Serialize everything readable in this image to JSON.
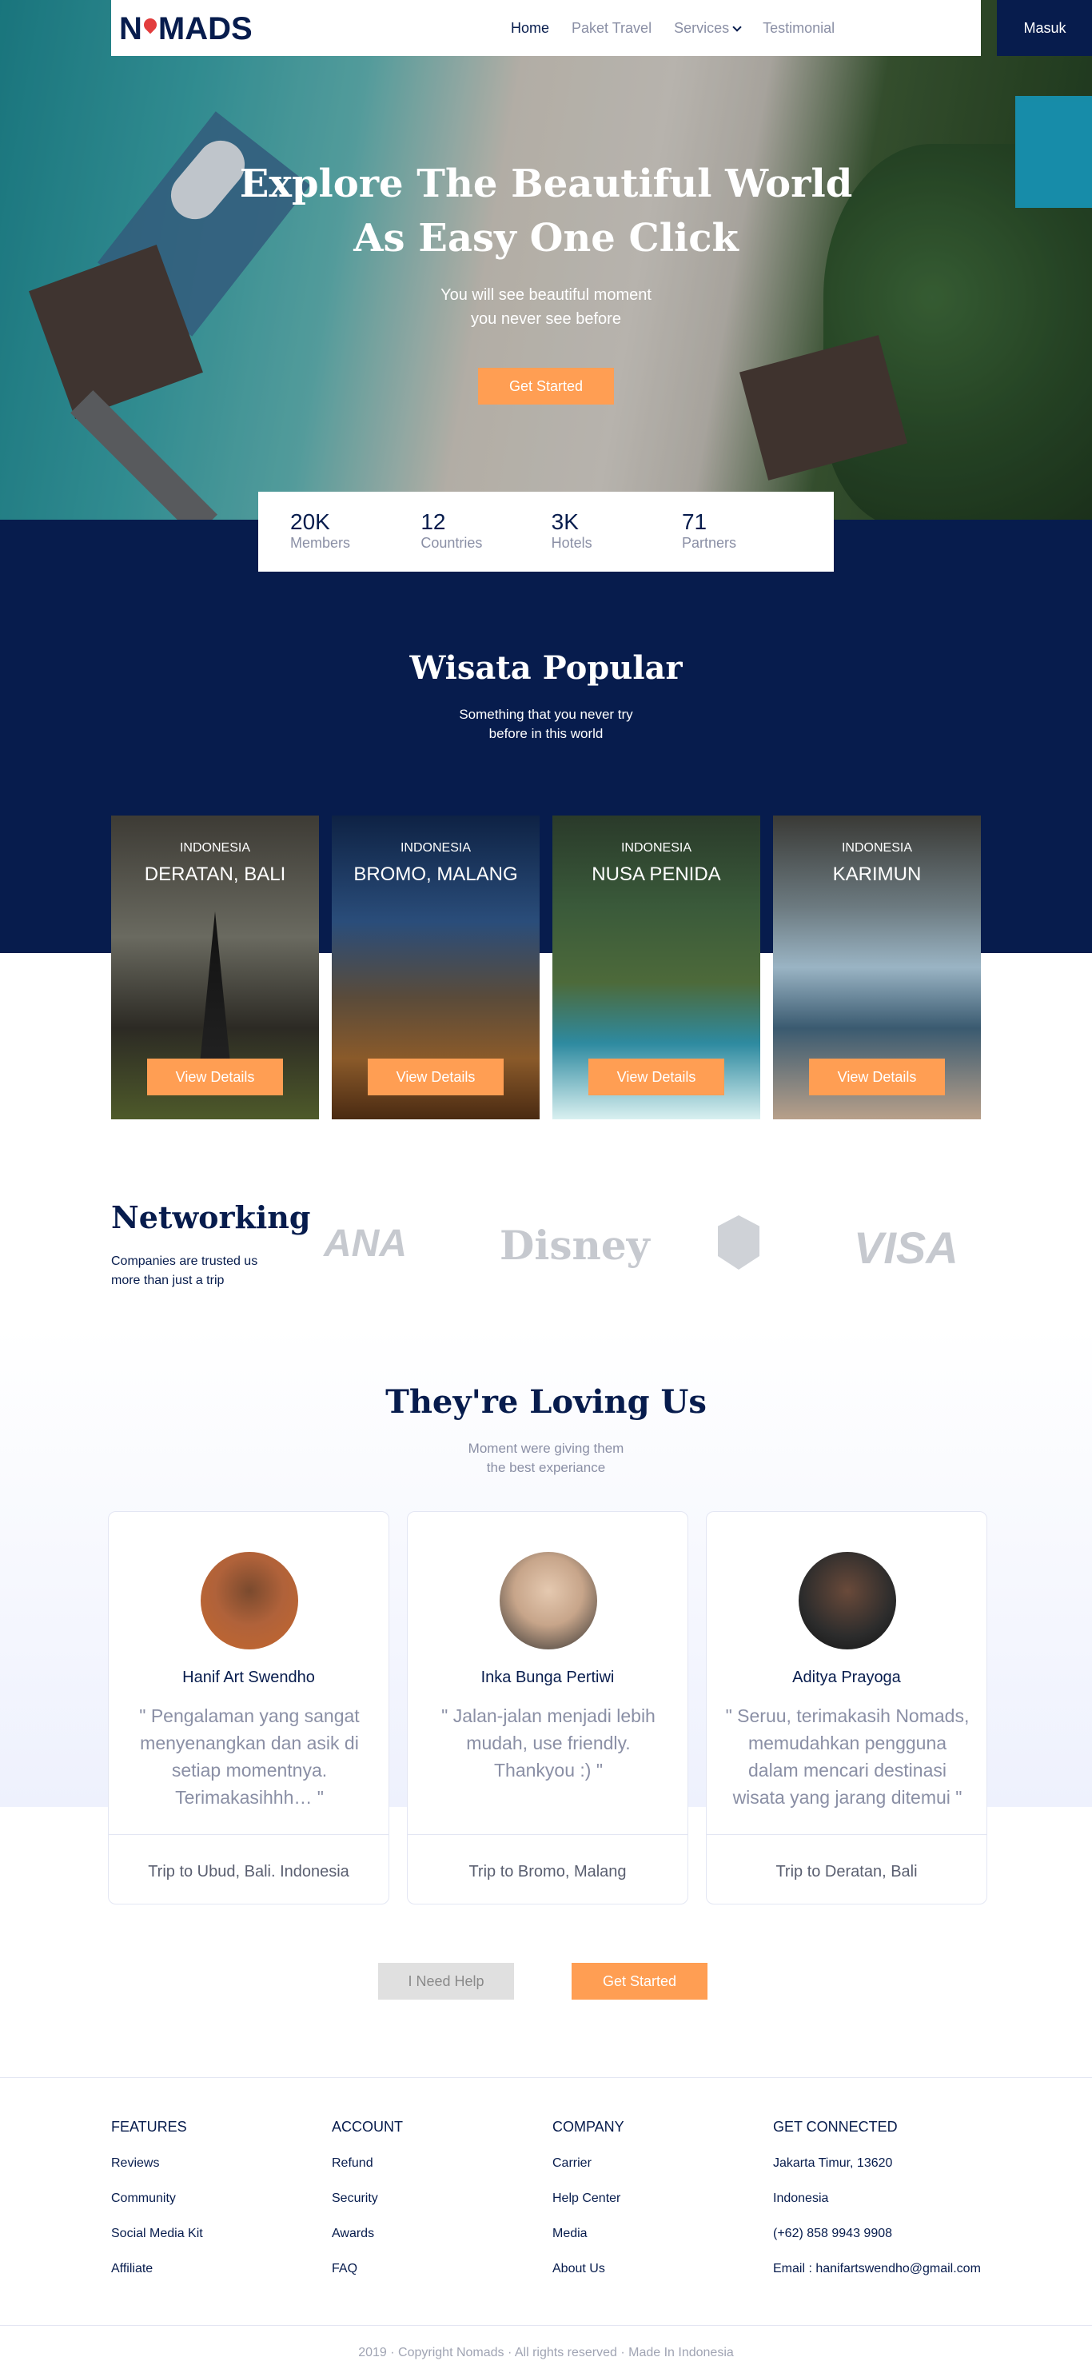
{
  "nav": {
    "logo": "NOMADS",
    "links": [
      "Home",
      "Paket Travel",
      "Services",
      "Testimonial"
    ],
    "masuk": "Masuk"
  },
  "hero": {
    "title_line1": "Explore The Beautiful World",
    "title_line2": "As Easy One Click",
    "sub_line1": "You will see beautiful moment",
    "sub_line2": "you never see before",
    "cta": "Get Started"
  },
  "stats": [
    {
      "num": "20K",
      "label": "Members"
    },
    {
      "num": "12",
      "label": "Countries"
    },
    {
      "num": "3K",
      "label": "Hotels"
    },
    {
      "num": "71",
      "label": "Partners"
    }
  ],
  "popular": {
    "title": "Wisata Popular",
    "sub_line1": "Something that you never try",
    "sub_line2": "before in this world",
    "cards": [
      {
        "country": "INDONESIA",
        "city": "DERATAN, BALI",
        "button": "View Details"
      },
      {
        "country": "INDONESIA",
        "city": "BROMO, MALANG",
        "button": "View Details"
      },
      {
        "country": "INDONESIA",
        "city": "NUSA PENIDA",
        "button": "View Details"
      },
      {
        "country": "INDONESIA",
        "city": "KARIMUN",
        "button": "View Details"
      }
    ]
  },
  "networking": {
    "title": "Networking",
    "sub_line1": "Companies are trusted us",
    "sub_line2": "more than just a trip",
    "partners": [
      "ANA",
      "Disney",
      "VISA"
    ]
  },
  "testimonials": {
    "title": "They're Loving Us",
    "sub_line1": "Moment were giving them",
    "sub_line2": "the best experiance",
    "items": [
      {
        "name": "Hanif Art Swendho",
        "quote": "\" Pengalaman yang sangat menyenangkan dan asik di setiap momentnya. Terimakasihhh… \"",
        "trip": "Trip to Ubud, Bali. Indonesia"
      },
      {
        "name": "Inka Bunga Pertiwi",
        "quote": "\" Jalan-jalan menjadi lebih mudah, use friendly. Thankyou :) \"",
        "trip": "Trip to Bromo, Malang"
      },
      {
        "name": "Aditya Prayoga",
        "quote": "\" Seruu, terimakasih Nomads, memudahkan pengguna dalam mencari destinasi wisata yang jarang ditemui \"",
        "trip": "Trip to Deratan, Bali"
      }
    ]
  },
  "cta_buttons": {
    "help": "I Need Help",
    "start": "Get Started"
  },
  "footer": {
    "features": {
      "title": "FEATURES",
      "links": [
        "Reviews",
        "Community",
        "Social Media Kit",
        "Affiliate"
      ]
    },
    "account": {
      "title": "ACCOUNT",
      "links": [
        "Refund",
        "Security",
        "Awards",
        "FAQ"
      ]
    },
    "company": {
      "title": "COMPANY",
      "links": [
        "Carrier",
        "Help Center",
        "Media",
        "About Us"
      ]
    },
    "connected": {
      "title": "GET CONNECTED",
      "links": [
        "Jakarta Timur, 13620",
        "Indonesia",
        "(+62) 858 9943 9908",
        "Email : hanifartswendho@gmail.com"
      ]
    },
    "copyright": "2019 · Copyright Nomads · All rights reserved · Made In Indonesia"
  },
  "colors": {
    "primary": "#071c4d",
    "accent": "#ff9e53"
  }
}
